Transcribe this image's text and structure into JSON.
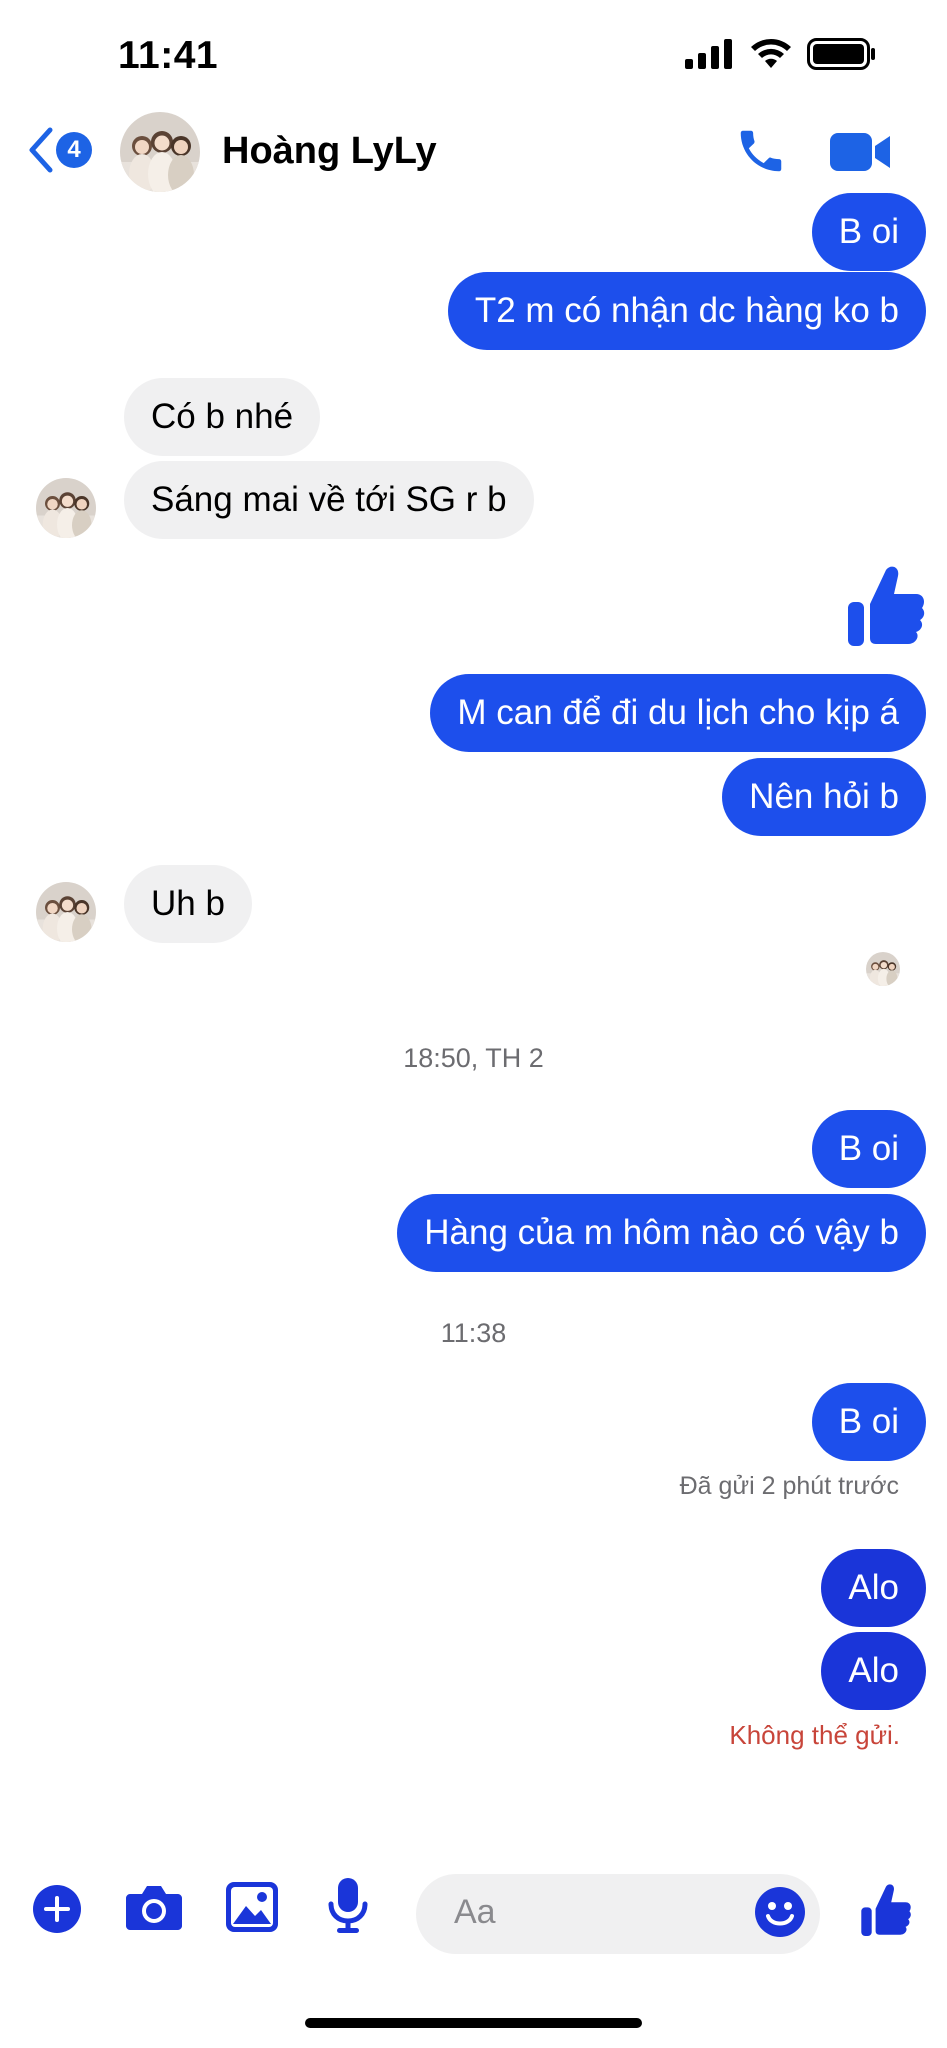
{
  "status_bar": {
    "time": "11:41"
  },
  "header": {
    "back_badge": "4",
    "contact_name": "Hoàng LyLy"
  },
  "messages": [
    {
      "side": "out",
      "text": "B oi"
    },
    {
      "side": "out",
      "text": "T2 m có nhận dc hàng ko b"
    },
    {
      "side": "in",
      "text": "Có b nhé"
    },
    {
      "side": "in",
      "text": "Sáng mai về tới SG r b"
    },
    {
      "side": "out",
      "type": "like"
    },
    {
      "side": "out",
      "text": "M can để đi du lịch cho kịp á"
    },
    {
      "side": "out",
      "text": "Nên hỏi b"
    },
    {
      "side": "in",
      "text": "Uh b"
    },
    {
      "side": "out",
      "text": "B oi"
    },
    {
      "side": "out",
      "text": "Hàng của m hôm nào có vậy b"
    },
    {
      "side": "out",
      "text": "B oi"
    },
    {
      "side": "out",
      "text": "Alo"
    },
    {
      "side": "out",
      "text": "Alo"
    }
  ],
  "timestamps": [
    "18:50, TH 2",
    "11:38"
  ],
  "delivery": {
    "sent": "Đã gửi 2 phút trước",
    "failed": "Không thể gửi."
  },
  "composer": {
    "placeholder": "Aa"
  },
  "colors": {
    "accent": "#1d4fec",
    "incoming": "#f0f0f1",
    "error": "#c8453a"
  }
}
